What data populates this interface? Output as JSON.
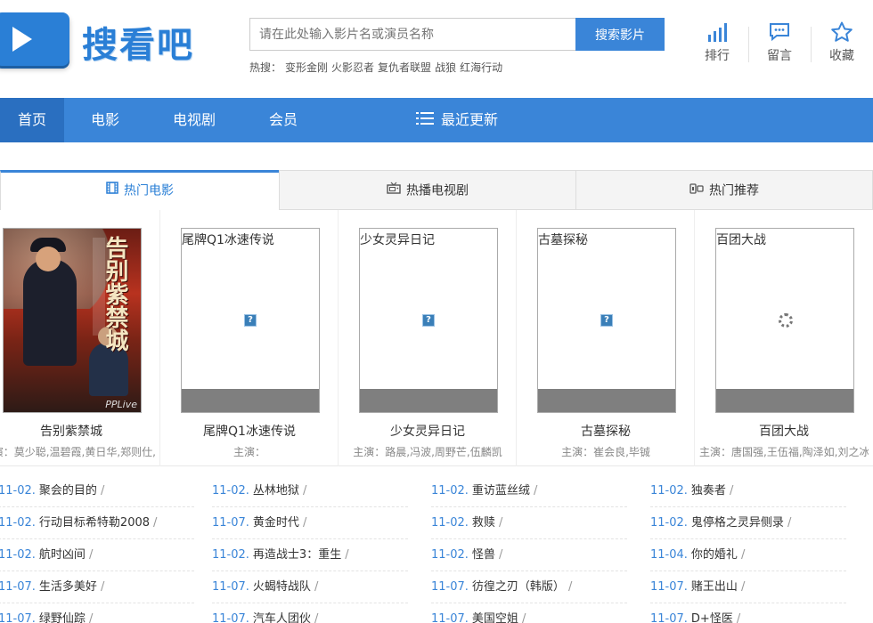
{
  "header": {
    "logo_text": "搜看吧",
    "search_placeholder": "请在此处输入影片名或演员名称",
    "search_button": "搜索影片",
    "hot_label": "热搜：",
    "hot_items": [
      "变形金刚",
      "火影忍者",
      "复仇者联盟",
      "战狼",
      "红海行动"
    ],
    "icons": [
      {
        "label": "排行",
        "icon": "bar-chart-icon"
      },
      {
        "label": "留言",
        "icon": "message-icon"
      },
      {
        "label": "收藏",
        "icon": "star-icon"
      }
    ]
  },
  "nav": {
    "items": [
      "首页",
      "电影",
      "电视剧",
      "会员"
    ],
    "latest": "最近更新",
    "active": "首页"
  },
  "tabs": [
    {
      "label": "热门电影",
      "icon": "film-icon",
      "active": true
    },
    {
      "label": "热播电视剧",
      "icon": "tv-icon",
      "active": false
    },
    {
      "label": "热门推荐",
      "icon": "recommend-icon",
      "active": false
    }
  ],
  "movies": [
    {
      "title": "告别紫禁城",
      "starring": "主演：莫少聪,温碧霞,黄日华,郑则仕,",
      "poster": "image",
      "poster_text": "告别紫禁城",
      "poster_logo": "PPLive"
    },
    {
      "title": "尾牌Q1冰速传说",
      "starring": "主演：",
      "poster": "broken",
      "alt": "尾牌Q1冰速传说"
    },
    {
      "title": "少女灵异日记",
      "starring": "主演：路晨,冯波,周野芒,伍麟凯",
      "poster": "broken",
      "alt": "少女灵异日记"
    },
    {
      "title": "古墓探秘",
      "starring": "主演：崔会良,毕铖",
      "poster": "broken",
      "alt": "古墓探秘"
    },
    {
      "title": "百团大战",
      "starring": "主演：唐国强,王伍福,陶泽如,刘之冰",
      "poster": "loading",
      "alt": "百团大战"
    }
  ],
  "lists": [
    [
      {
        "date": "11-02.",
        "title": "聚会的目的"
      },
      {
        "date": "11-02.",
        "title": "行动目标希特勒2008"
      },
      {
        "date": "11-02.",
        "title": "航时凶间"
      },
      {
        "date": "11-07.",
        "title": "生活多美好"
      },
      {
        "date": "11-07.",
        "title": "绿野仙踪"
      }
    ],
    [
      {
        "date": "11-02.",
        "title": "丛林地狱"
      },
      {
        "date": "11-07.",
        "title": "黄金时代"
      },
      {
        "date": "11-02.",
        "title": "再造战士3：重生"
      },
      {
        "date": "11-07.",
        "title": "火蝎特战队"
      },
      {
        "date": "11-07.",
        "title": "汽车人团伙"
      }
    ],
    [
      {
        "date": "11-02.",
        "title": "重访蓝丝绒"
      },
      {
        "date": "11-02.",
        "title": "救赎"
      },
      {
        "date": "11-02.",
        "title": "怪兽"
      },
      {
        "date": "11-07.",
        "title": "彷徨之刃（韩版）"
      },
      {
        "date": "11-07.",
        "title": "美国空姐"
      }
    ],
    [
      {
        "date": "11-02.",
        "title": "独奏者"
      },
      {
        "date": "11-02.",
        "title": "鬼停格之灵异侧录"
      },
      {
        "date": "11-04.",
        "title": "你的婚礼"
      },
      {
        "date": "11-07.",
        "title": "赌王出山"
      },
      {
        "date": "11-07.",
        "title": "D+怪医"
      }
    ]
  ],
  "separator": "/",
  "colors": {
    "accent": "#3a85d8",
    "nav_active": "#2a6fc0"
  }
}
